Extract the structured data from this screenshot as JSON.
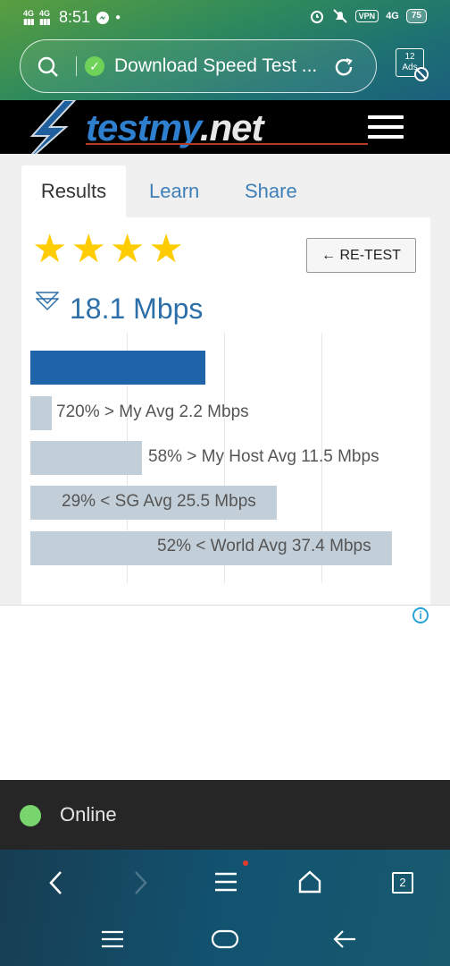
{
  "status_bar": {
    "network1": "4G",
    "network2": "4G",
    "time": "8:51",
    "vpn": "VPN",
    "data": "4G",
    "battery": "75"
  },
  "browser": {
    "address_text": "Download Speed Test ...",
    "adblock_count": "12",
    "adblock_label": "Ads",
    "tabs_count": "2"
  },
  "site": {
    "logo_part1": "testmy",
    "logo_part2": ".net",
    "tabs": [
      "Results",
      "Learn",
      "Share"
    ],
    "retest_label": "← RE-TEST",
    "rating_stars": 4,
    "speed": "18.1 Mbps",
    "speed_value": 18.1,
    "comparisons": [
      {
        "label": "720% > My Avg 2.2 Mbps",
        "value": 2.2
      },
      {
        "label": "58% > My Host Avg 11.5 Mbps",
        "value": 11.5
      },
      {
        "label": "29% < SG Avg 25.5 Mbps",
        "value": 25.5
      },
      {
        "label": "52% < World Avg 37.4 Mbps",
        "value": 37.4
      }
    ]
  },
  "status": {
    "online_text": "Online",
    "online_color": "#79d56d"
  },
  "colors": {
    "bar_primary": "#1f64a8",
    "bar_compare": "#c2cfd9",
    "star": "#ffcc00"
  }
}
